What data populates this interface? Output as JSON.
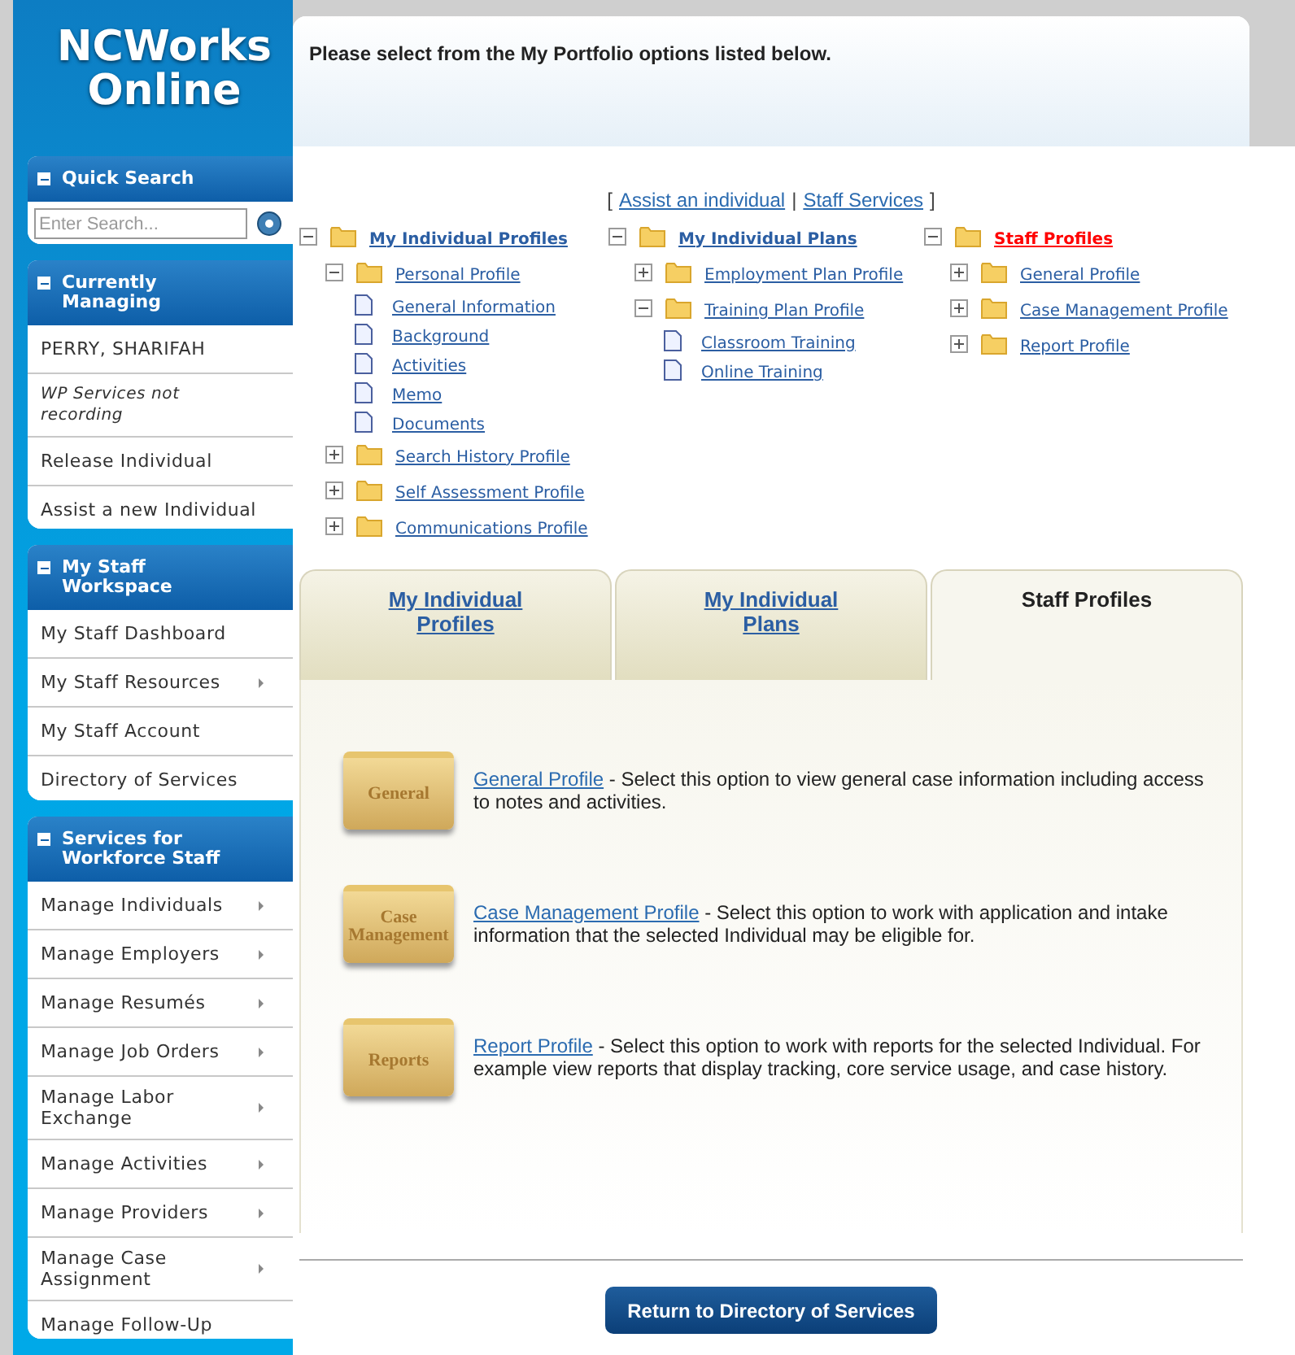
{
  "logo": {
    "line_1": "NCWorks",
    "line_2": "Online"
  },
  "sidebar": {
    "sections": [
      {
        "title": "Quick Search",
        "expanded": true,
        "search": {
          "placeholder": "Enter Search..."
        }
      },
      {
        "title": "Currently Managing",
        "expanded": true,
        "items": [
          {
            "kind": "name",
            "label": "PERRY, SHARIFAH",
            "submenu": false
          },
          {
            "kind": "note",
            "label": "WP Services not recording",
            "submenu": false
          },
          {
            "kind": "link",
            "label": "Release Individual",
            "submenu": false
          },
          {
            "kind": "link",
            "label": "Assist a new Individual",
            "submenu": false
          }
        ]
      },
      {
        "title": "My Staff Workspace",
        "expanded": true,
        "items": [
          {
            "kind": "link",
            "label": "My Staff Dashboard",
            "submenu": false
          },
          {
            "kind": "link",
            "label": "My Staff Resources",
            "submenu": true
          },
          {
            "kind": "link",
            "label": "My Staff Account",
            "submenu": false
          },
          {
            "kind": "link",
            "label": "Directory of Services",
            "submenu": false
          }
        ]
      },
      {
        "title": "Services for Workforce Staff",
        "expanded": true,
        "items": [
          {
            "kind": "link",
            "label": "Manage Individuals",
            "submenu": true
          },
          {
            "kind": "link",
            "label": "Manage Employers",
            "submenu": true
          },
          {
            "kind": "link",
            "label": "Manage Resumés",
            "submenu": true
          },
          {
            "kind": "link",
            "label": "Manage Job Orders",
            "submenu": true
          },
          {
            "kind": "link",
            "label": "Manage Labor Exchange",
            "submenu": true
          },
          {
            "kind": "link",
            "label": "Manage Activities",
            "submenu": true
          },
          {
            "kind": "link",
            "label": "Manage Providers",
            "submenu": true
          },
          {
            "kind": "link",
            "label": "Manage Case Assignment",
            "submenu": true
          },
          {
            "kind": "link",
            "label": "Manage Follow-Up",
            "submenu": false
          }
        ]
      }
    ]
  },
  "header": {
    "title": "Please select from the My Portfolio options listed below."
  },
  "top_links": {
    "open": "[",
    "items": [
      "Assist an individual",
      "Staff Services"
    ],
    "separator": "|",
    "close": "]"
  },
  "tree": [
    {
      "kind": "folder",
      "label": "My Individual Profiles",
      "expanded": true,
      "current": false,
      "children": [
        {
          "kind": "folder",
          "label": "Personal Profile",
          "expanded": true,
          "children": [
            {
              "kind": "page",
              "label": "General Information"
            },
            {
              "kind": "page",
              "label": "Background"
            },
            {
              "kind": "page",
              "label": "Activities"
            },
            {
              "kind": "page",
              "label": "Memo"
            },
            {
              "kind": "page",
              "label": "Documents"
            }
          ]
        },
        {
          "kind": "folder",
          "label": "Search History Profile",
          "expanded": false
        },
        {
          "kind": "folder",
          "label": "Self Assessment Profile",
          "expanded": false
        },
        {
          "kind": "folder",
          "label": "Communications Profile",
          "expanded": false
        }
      ]
    },
    {
      "kind": "folder",
      "label": "My Individual Plans",
      "expanded": true,
      "current": false,
      "children": [
        {
          "kind": "folder",
          "label": "Employment Plan Profile",
          "expanded": false
        },
        {
          "kind": "folder",
          "label": "Training Plan Profile",
          "expanded": true,
          "children": [
            {
              "kind": "page",
              "label": "Classroom Training"
            },
            {
              "kind": "page",
              "label": "Online Training"
            }
          ]
        }
      ]
    },
    {
      "kind": "folder",
      "label": "Staff Profiles",
      "expanded": true,
      "current": true,
      "children": [
        {
          "kind": "folder",
          "label": "General Profile",
          "expanded": false
        },
        {
          "kind": "folder",
          "label": "Case Management Profile",
          "expanded": false
        },
        {
          "kind": "folder",
          "label": "Report Profile",
          "expanded": false
        }
      ]
    }
  ],
  "tabs": [
    {
      "label": "My Individual Profiles",
      "selected": false
    },
    {
      "label": "My Individual Plans",
      "selected": false
    },
    {
      "label": "Staff Profiles",
      "selected": true
    }
  ],
  "options": [
    {
      "folder_label": "General",
      "link": "General Profile",
      "text": " - Select this option to view general case information including access to notes and activities."
    },
    {
      "folder_label": "Case Management",
      "link": "Case Management Profile",
      "text": " - Select this option to work with application and intake information that the selected Individual may be eligible for."
    },
    {
      "folder_label": "Reports",
      "link": "Report Profile",
      "text": " - Select this option to work with reports for the selected Individual. For example view reports that display tracking, core service usage, and case history."
    }
  ],
  "footer_button": "Return to Directory of Services"
}
